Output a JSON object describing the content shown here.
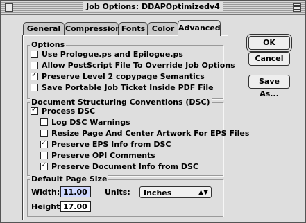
{
  "window": {
    "title": "Job Options: DDAPOptimizedv4"
  },
  "tabs": [
    "General",
    "Compression",
    "Fonts",
    "Color",
    "Advanced"
  ],
  "active_tab": "Advanced",
  "buttons": {
    "ok": "OK",
    "cancel": "Cancel",
    "save_as": "Save As..."
  },
  "options": {
    "title": "Options",
    "items": [
      {
        "label": "Use Prologue.ps and Epilogue.ps",
        "checked": false
      },
      {
        "label": "Allow PostScript File To Override Job Options",
        "checked": false
      },
      {
        "label": "Preserve Level 2 copypage Semantics",
        "checked": true
      },
      {
        "label": "Save Portable Job Ticket Inside PDF File",
        "checked": false
      }
    ]
  },
  "dsc": {
    "title": "Document Structuring Conventions (DSC)",
    "process": {
      "label": "Process DSC",
      "checked": true
    },
    "items": [
      {
        "label": "Log DSC Warnings",
        "checked": false
      },
      {
        "label": "Resize Page And Center Artwork For EPS Files",
        "checked": false
      },
      {
        "label": "Preserve EPS Info from DSC",
        "checked": true
      },
      {
        "label": "Preserve OPI Comments",
        "checked": false
      },
      {
        "label": "Preserve Document Info from DSC",
        "checked": true
      }
    ]
  },
  "page_size": {
    "title": "Default Page Size",
    "width_label": "Width:",
    "width_value": "11.00",
    "height_label": "Height:",
    "height_value": "17.00",
    "units_label": "Units:",
    "units_value": "Inches"
  }
}
